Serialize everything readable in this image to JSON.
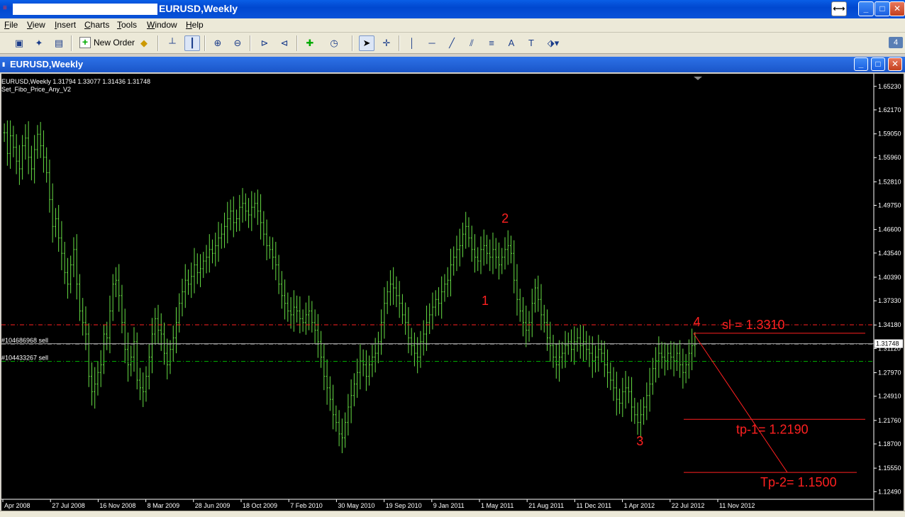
{
  "window": {
    "app_icon": "mt4-icon",
    "title": "EURUSD,Weekly"
  },
  "menu": {
    "items": [
      {
        "label": "File",
        "key": "F",
        "rest": "ile"
      },
      {
        "label": "View",
        "key": "V",
        "rest": "iew"
      },
      {
        "label": "Insert",
        "key": "I",
        "rest": "nsert"
      },
      {
        "label": "Charts",
        "key": "C",
        "rest": "harts"
      },
      {
        "label": "Tools",
        "key": "T",
        "rest": "ools"
      },
      {
        "label": "Window",
        "key": "W",
        "rest": "indow"
      },
      {
        "label": "Help",
        "key": "H",
        "rest": "elp"
      }
    ]
  },
  "toolbar": {
    "new_order_label": "New Order",
    "badge": "4",
    "text_tool": "A",
    "textlabel_tool": "T"
  },
  "chart_window": {
    "title": "EURUSD,Weekly"
  },
  "chart_data": {
    "type": "bar",
    "symbol_line": "EURUSD,Weekly  1.31794 1.33077 1.31436 1.31748",
    "indicator_line": "Set_Fibo_Price_Any_V2",
    "current_price": "1.31748",
    "price_axis": [
      "1.65230",
      "1.62170",
      "1.59050",
      "1.55960",
      "1.52810",
      "1.49750",
      "1.46600",
      "1.43540",
      "1.40390",
      "1.37330",
      "1.34180",
      "1.31120",
      "1.27970",
      "1.24910",
      "1.21760",
      "1.18700",
      "1.15550",
      "1.12490"
    ],
    "time_axis": [
      "Apr 2008",
      "27 Jul 2008",
      "16 Nov 2008",
      "8 Mar 2009",
      "28 Jun 2009",
      "18 Oct 2009",
      "7 Feb 2010",
      "30 May 2010",
      "19 Sep 2010",
      "9 Jan 2011",
      "1 May 2011",
      "21 Aug 2011",
      "11 Dec 2011",
      "1 Apr 2012",
      "22 Jul 2012",
      "11 Nov 2012"
    ],
    "ylim": [
      1.115,
      1.665
    ],
    "orders": [
      {
        "label": "#104686968 sell",
        "price": 1.317
      },
      {
        "label": "#104433267 sell",
        "price": 1.2945
      }
    ],
    "stop_level_price": 1.342,
    "wave_labels": [
      {
        "text": "1",
        "x_index": 0.529,
        "price": 1.368
      },
      {
        "text": "2",
        "x_index": 0.551,
        "price": 1.475
      },
      {
        "text": "3",
        "x_index": 0.7,
        "price": 1.185
      },
      {
        "text": "4",
        "x_index": 0.763,
        "price": 1.34
      }
    ],
    "targets": [
      {
        "text": "sl = 1.3310",
        "price": 1.331
      },
      {
        "text": "tp-1= 1.2190",
        "price": 1.219
      },
      {
        "text": "Tp-2= 1.1500",
        "price": 1.15
      }
    ],
    "closes": [
      1.592,
      1.565,
      1.588,
      1.573,
      1.555,
      1.545,
      1.575,
      1.585,
      1.56,
      1.545,
      1.57,
      1.59,
      1.575,
      1.56,
      1.54,
      1.505,
      1.47,
      1.48,
      1.455,
      1.435,
      1.41,
      1.395,
      1.42,
      1.44,
      1.395,
      1.36,
      1.345,
      1.33,
      1.275,
      1.255,
      1.265,
      1.28,
      1.29,
      1.33,
      1.325,
      1.36,
      1.395,
      1.4,
      1.38,
      1.345,
      1.31,
      1.29,
      1.3,
      1.32,
      1.27,
      1.26,
      1.255,
      1.275,
      1.3,
      1.33,
      1.35,
      1.335,
      1.33,
      1.305,
      1.29,
      1.31,
      1.325,
      1.345,
      1.37,
      1.385,
      1.4,
      1.395,
      1.405,
      1.42,
      1.41,
      1.415,
      1.425,
      1.43,
      1.44,
      1.435,
      1.445,
      1.455,
      1.46,
      1.47,
      1.48,
      1.49,
      1.475,
      1.48,
      1.495,
      1.5,
      1.49,
      1.485,
      1.495,
      1.5,
      1.49,
      1.475,
      1.46,
      1.445,
      1.44,
      1.43,
      1.42,
      1.395,
      1.38,
      1.37,
      1.36,
      1.355,
      1.365,
      1.36,
      1.35,
      1.345,
      1.355,
      1.36,
      1.345,
      1.335,
      1.32,
      1.3,
      1.275,
      1.26,
      1.245,
      1.225,
      1.215,
      1.2,
      1.195,
      1.215,
      1.235,
      1.25,
      1.265,
      1.28,
      1.295,
      1.29,
      1.275,
      1.29,
      1.3,
      1.305,
      1.32,
      1.345,
      1.37,
      1.385,
      1.395,
      1.39,
      1.38,
      1.37,
      1.355,
      1.345,
      1.325,
      1.315,
      1.305,
      1.3,
      1.32,
      1.33,
      1.345,
      1.355,
      1.365,
      1.375,
      1.37,
      1.385,
      1.395,
      1.4,
      1.42,
      1.43,
      1.44,
      1.445,
      1.46,
      1.47,
      1.455,
      1.44,
      1.43,
      1.425,
      1.44,
      1.445,
      1.435,
      1.43,
      1.44,
      1.43,
      1.42,
      1.43,
      1.44,
      1.445,
      1.435,
      1.4,
      1.375,
      1.36,
      1.345,
      1.335,
      1.345,
      1.37,
      1.39,
      1.375,
      1.355,
      1.345,
      1.325,
      1.315,
      1.3,
      1.29,
      1.3,
      1.305,
      1.315,
      1.32,
      1.31,
      1.32,
      1.325,
      1.315,
      1.32,
      1.31,
      1.305,
      1.295,
      1.3,
      1.31,
      1.305,
      1.29,
      1.28,
      1.27,
      1.26,
      1.245,
      1.24,
      1.255,
      1.26,
      1.255,
      1.235,
      1.225,
      1.215,
      1.225,
      1.235,
      1.25,
      1.265,
      1.285,
      1.295,
      1.305,
      1.3,
      1.295,
      1.305,
      1.3,
      1.295,
      1.305,
      1.29,
      1.28,
      1.29,
      1.305,
      1.315,
      1.3175
    ]
  }
}
